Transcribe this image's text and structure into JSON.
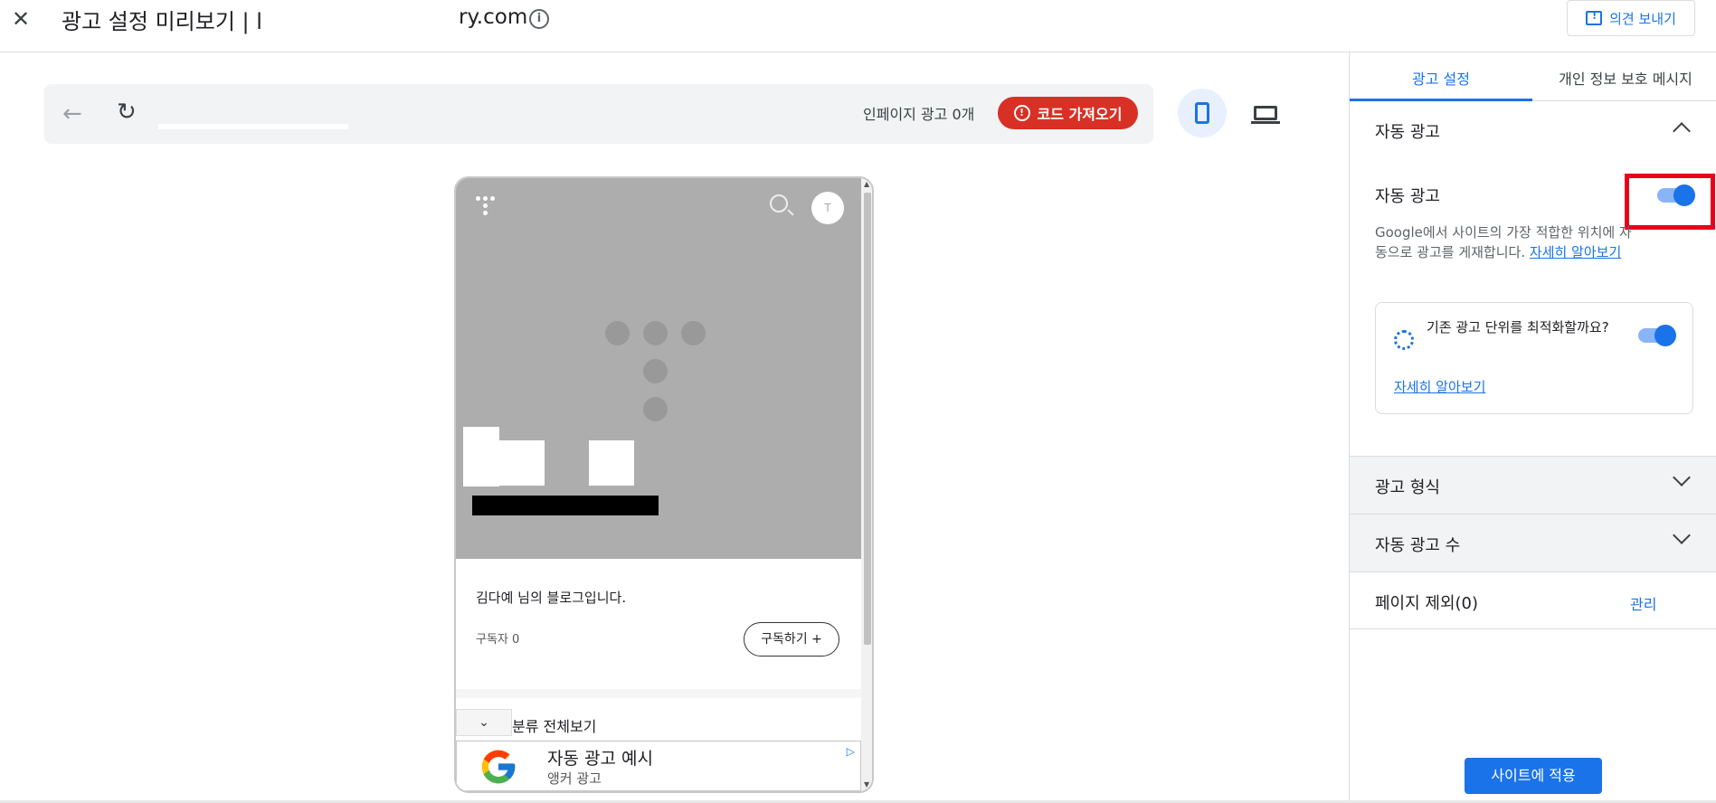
{
  "header": {
    "close_label": "✕",
    "title_prefix": "광고 설정 미리보기 | l",
    "title_suffix": "ry.com",
    "info_icon": "i",
    "feedback_label": "의견 보내기"
  },
  "toolbar": {
    "ad_count": "인페이지 광고 0개",
    "code_button": "코드 가져오기",
    "back_icon": "←",
    "reload_icon": "↻"
  },
  "phone": {
    "avatar_letter": "T",
    "blog_description": "김다예 님의 블로그입니다.",
    "subscribers": "구독자 0",
    "subscribe_button": "구독하기 +",
    "category_label": "분류 전체보기",
    "category_toggle": "⌄",
    "anchor_ad": {
      "title": "자동 광고 예시",
      "subtitle": "앵커 광고",
      "adchoice": "▷"
    }
  },
  "panel": {
    "tabs": [
      "광고 설정",
      "개인 정보 보호 메시지"
    ],
    "auto_ads_section": "자동 광고",
    "auto_ads_toggle_label": "자동 광고",
    "auto_ads_toggle_on": true,
    "description": "Google에서 사이트의 가장 적합한 위치에 자동으로 광고를 게재합니다.",
    "learn_more": "자세히 알아보기",
    "optimize_question": "기존 광고 단위를 최적화할까요?",
    "optimize_toggle_on": true,
    "optimize_learn_more": "자세히 알아보기",
    "ad_formats": "광고 형식",
    "ad_load": "자동 광고 수",
    "page_exclusions": "페이지 제외(0)",
    "manage": "관리",
    "apply_button": "사이트에 적용"
  },
  "colors": {
    "accent": "#1a73e8",
    "danger": "#d93025",
    "highlight": "#e8001c"
  }
}
